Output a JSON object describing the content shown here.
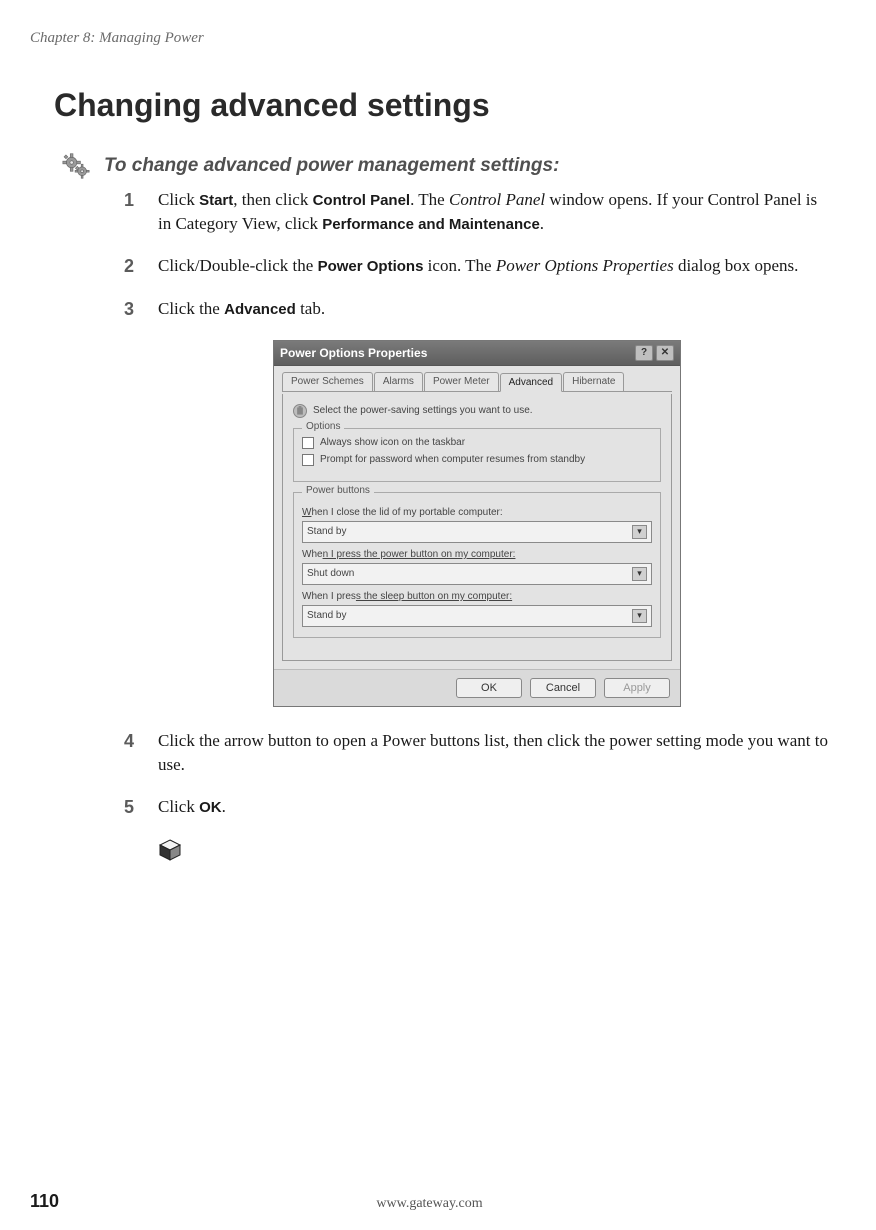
{
  "header": {
    "chapter": "Chapter 8: Managing Power"
  },
  "title": "Changing advanced settings",
  "task": {
    "heading": "To change advanced power management settings:"
  },
  "steps": {
    "s1": {
      "num": "1",
      "t1": "Click ",
      "b1": "Start",
      "t2": ", then click ",
      "b2": "Control Panel",
      "t3": ". The ",
      "i1": "Control Panel",
      "t4": " window opens. If your Control Panel is in Category View, click ",
      "b3": "Performance and Maintenance",
      "t5": "."
    },
    "s2": {
      "num": "2",
      "t1": "Click/Double-click the ",
      "b1": "Power Options",
      "t2": " icon. The ",
      "i1": "Power Options Properties",
      "t3": " dialog box opens."
    },
    "s3": {
      "num": "3",
      "t1": "Click the ",
      "b1": "Advanced",
      "t2": " tab."
    },
    "s4": {
      "num": "4",
      "t1": "Click the arrow button to open a Power buttons list, then click the power setting mode you want to use."
    },
    "s5": {
      "num": "5",
      "t1": "Click ",
      "b1": "OK",
      "t2": "."
    }
  },
  "dialog": {
    "title": "Power Options Properties",
    "tabs": {
      "schemes": "Power Schemes",
      "alarms": "Alarms",
      "meter": "Power Meter",
      "advanced": "Advanced",
      "hibernate": "Hibernate"
    },
    "hint": "Select the power-saving settings you want to use.",
    "options_legend": "Options",
    "chk1": "Always show icon on the taskbar",
    "chk2": "Prompt for password when computer resumes from standby",
    "pb_legend": "Power buttons",
    "lbl1a": "W",
    "lbl1b": "hen I close the lid of my portable computer:",
    "val1": "Stand by",
    "lbl2a": "Whe",
    "lbl2b": "n I press the power button on my computer:",
    "val2": "Shut down",
    "lbl3a": "When I pres",
    "lbl3b": "s the sleep button on my computer:",
    "val3": "Stand by",
    "ok": "OK",
    "cancel": "Cancel",
    "apply": "Apply"
  },
  "footer": {
    "page": "110",
    "url": "www.gateway.com"
  }
}
